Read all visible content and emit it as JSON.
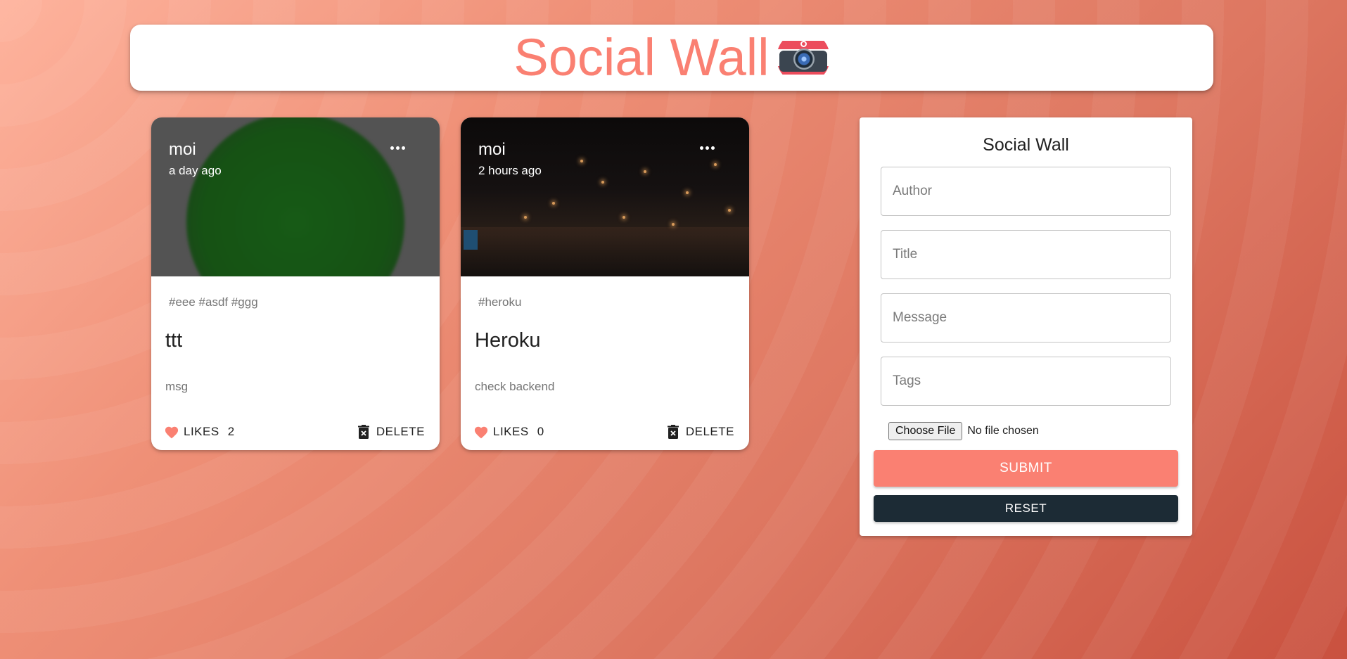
{
  "header": {
    "title": "Social Wall",
    "logo_icon": "camera-logo-icon"
  },
  "posts": [
    {
      "author": "moi",
      "time": "a day ago",
      "tags": "#eee #asdf #ggg",
      "title": "ttt",
      "message": "msg",
      "like_label": "LIKES",
      "like_count": "2",
      "delete_label": "DELETE"
    },
    {
      "author": "moi",
      "time": "2 hours ago",
      "tags": "#heroku",
      "title": "Heroku",
      "message": "check backend",
      "like_label": "LIKES",
      "like_count": "0",
      "delete_label": "DELETE"
    }
  ],
  "form": {
    "title": "Social Wall",
    "author_placeholder": "Author",
    "title_placeholder": "Title",
    "message_placeholder": "Message",
    "tags_placeholder": "Tags",
    "file_button": "Choose File",
    "file_status": "No file chosen",
    "submit_label": "SUBMIT",
    "reset_label": "RESET"
  },
  "colors": {
    "accent": "#fa8072",
    "dark_button": "#1c2b35",
    "background_start": "#feb39d",
    "background_end": "#c9513f"
  }
}
